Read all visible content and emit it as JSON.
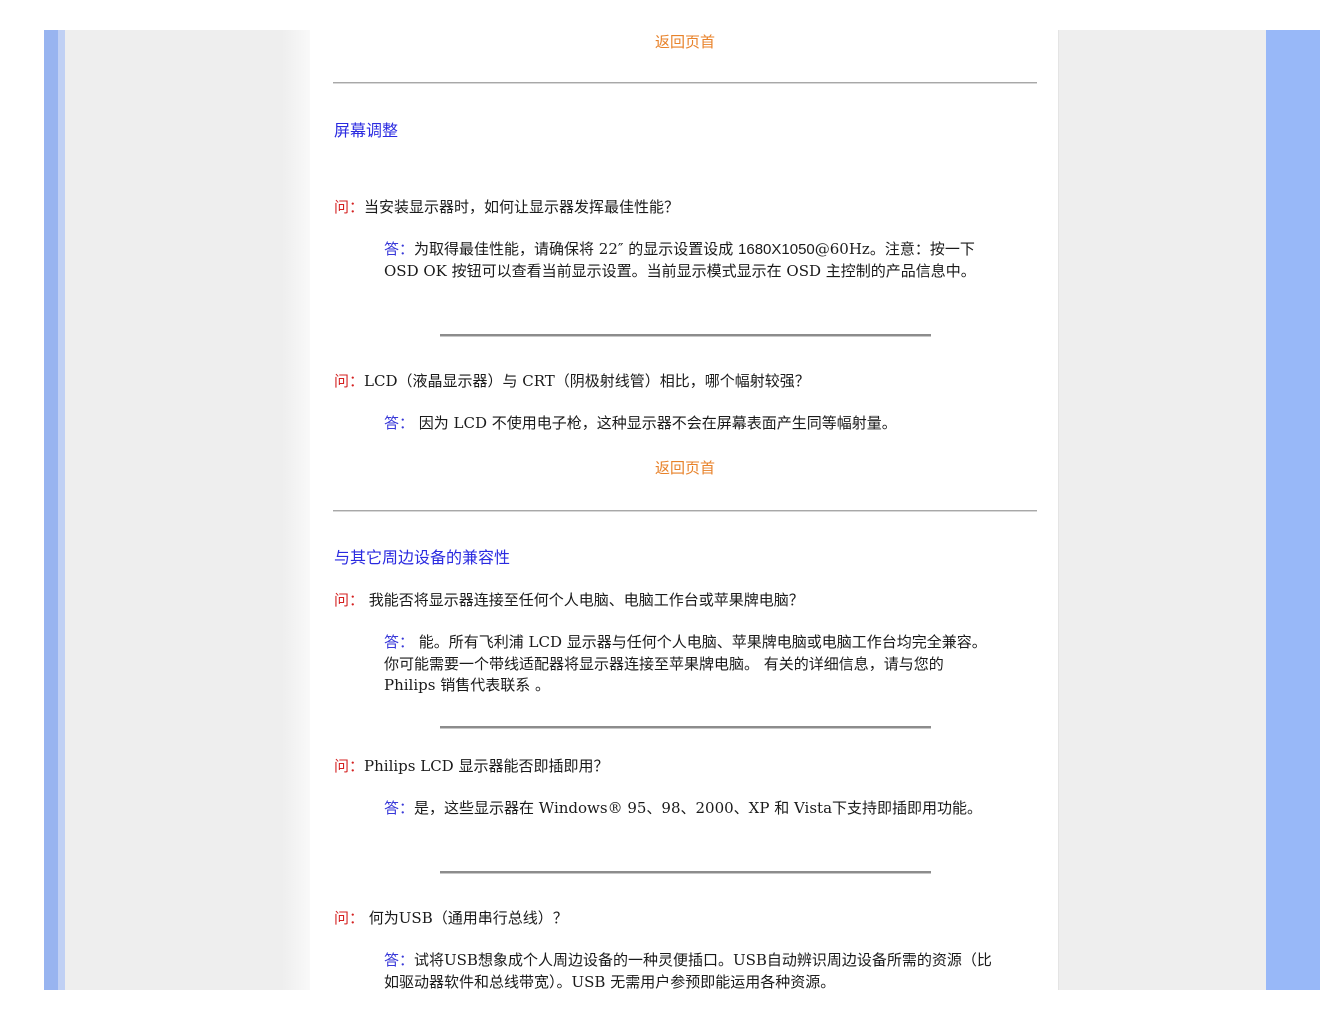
{
  "back_link": "返回页首",
  "sections": {
    "screen": {
      "title": "屏幕调整",
      "q1": {
        "q_prefix": "问：",
        "q_text": "当安装显示器时，如何让显示器发挥最佳性能？",
        "a_prefix": "答：",
        "a_text_1": "为取得最佳性能，请确保将 22″ 的显示设置设成 ",
        "a_resolution": "1680X1050",
        "a_text_2": "@60Hz。注意：按一下 OSD OK 按钮可以查看当前显示设置。当前显示模式显示在 OSD 主控制的产品信息中。"
      },
      "q2": {
        "q_prefix": "问：",
        "q_text": "LCD（液晶显示器）与 CRT（阴极射线管）相比，哪个幅射较强？",
        "a_prefix": "答：",
        "a_text": " 因为 LCD 不使用电子枪，这种显示器不会在屏幕表面产生同等幅射量。"
      }
    },
    "compat": {
      "title": "与其它周边设备的兼容性",
      "q1": {
        "q_prefix": "问：",
        "q_text": " 我能否将显示器连接至任何个人电脑、电脑工作台或苹果牌电脑？",
        "a_prefix": "答：",
        "a_text": " 能。所有飞利浦 LCD 显示器与任何个人电脑、苹果牌电脑或电脑工作台均完全兼容。你可能需要一个带线适配器将显示器连接至苹果牌电脑。 有关的详细信息，请与您的 Philips 销售代表联系 。"
      },
      "q2": {
        "q_prefix": "问：",
        "q_text": "Philips LCD 显示器能否即插即用？",
        "a_prefix": "答：",
        "a_text": "是，这些显示器在 Windows® 95、98、2000、XP 和 Vista下支持即插即用功能。"
      },
      "q3": {
        "q_prefix": "问：",
        "q_text": " 何为USB（通用串行总线）？",
        "a_prefix": "答：",
        "a_text": "试将USB想象成个人周边设备的一种灵便插口。USB自动辨识周边设备所需的资源（比如驱动器软件和总线带宽）。USB 无需用户参预即能运用各种资源。"
      }
    }
  },
  "colors": {
    "blue_bar": "#98b4f0",
    "link_orange": "#e8822a",
    "heading_blue": "#2a2ae0",
    "question_red": "#d42020",
    "answer_blue": "#3838d8"
  }
}
